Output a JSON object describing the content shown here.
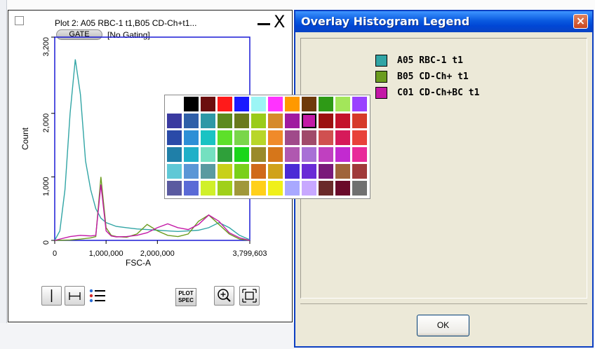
{
  "plot": {
    "title": "Plot 2: A05 RBC-1 t1,B05 CD-Ch+t1...",
    "gate_label": "GATE",
    "gating_status": "[No Gating]",
    "close_glyph": "X",
    "toolbar": {
      "plot_spec_line1": "PLOT",
      "plot_spec_line2": "SPEC"
    }
  },
  "chart_data": {
    "type": "line",
    "title": "",
    "xlabel": "FSC-A",
    "ylabel": "Count",
    "xlim": [
      0,
      3799603
    ],
    "ylim": [
      0,
      3200
    ],
    "x_tick_labels": [
      "0",
      "1,000,000",
      "2,000,000",
      "3,799,603"
    ],
    "x_tick_values": [
      0,
      1000000,
      2000000,
      3799603
    ],
    "y_tick_labels": [
      "0",
      "1,000",
      "2,000",
      "3,200"
    ],
    "y_tick_values": [
      0,
      1000,
      2000,
      3200
    ],
    "series": [
      {
        "color": "#31a5a5",
        "x": [
          0,
          100000,
          200000,
          300000,
          400000,
          500000,
          600000,
          700000,
          800000,
          900000,
          1000000,
          1200000,
          1400000,
          1600000,
          1800000,
          2000000,
          2200000,
          2400000,
          2600000,
          2800000,
          3000000,
          3200000,
          3400000,
          3600000,
          3799603
        ],
        "values": [
          0,
          150,
          800,
          2000,
          2850,
          2300,
          1250,
          800,
          500,
          350,
          280,
          220,
          200,
          180,
          170,
          160,
          150,
          140,
          150,
          160,
          200,
          280,
          200,
          80,
          10
        ]
      },
      {
        "color": "#6b9c1f",
        "x": [
          0,
          300000,
          500000,
          700000,
          800000,
          900000,
          1000000,
          1100000,
          1200000,
          1400000,
          1600000,
          1800000,
          2000000,
          2200000,
          2400000,
          2600000,
          2800000,
          3000000,
          3200000,
          3400000,
          3600000,
          3799603
        ],
        "values": [
          0,
          5,
          20,
          40,
          60,
          1000,
          200,
          80,
          60,
          50,
          100,
          250,
          150,
          80,
          60,
          100,
          300,
          400,
          250,
          100,
          20,
          0
        ]
      },
      {
        "color": "#c318a6",
        "x": [
          0,
          300000,
          500000,
          700000,
          800000,
          900000,
          1000000,
          1100000,
          1200000,
          1400000,
          1600000,
          1800000,
          2000000,
          2200000,
          2400000,
          2600000,
          2800000,
          3000000,
          3200000,
          3400000,
          3600000,
          3799603
        ],
        "values": [
          0,
          60,
          80,
          70,
          80,
          880,
          150,
          70,
          55,
          60,
          80,
          120,
          200,
          260,
          200,
          170,
          250,
          400,
          300,
          120,
          40,
          0
        ]
      }
    ]
  },
  "palette": {
    "colors": [
      "#ffffff",
      "#000000",
      "#6b0e0e",
      "#ff1a1a",
      "#1a1aff",
      "#9cf5f5",
      "#ff33ff",
      "#ff9900",
      "#6e3a0b",
      "#2e9a16",
      "#a3e65a",
      "#9a42ff",
      "#3a3aa0",
      "#2f5fa8",
      "#2e98a6",
      "#5d8a1e",
      "#6a7a1c",
      "#9acc1a",
      "#d68a2a",
      "#a01aa0",
      "#c21aa6",
      "#9c1010",
      "#c4122a",
      "#d63a2a",
      "#2a4aa8",
      "#2d8fd6",
      "#19c3c3",
      "#5de02a",
      "#79d64a",
      "#b8d62a",
      "#f08a2a",
      "#a04a8a",
      "#a04a6a",
      "#d05050",
      "#d61a5a",
      "#e8413a",
      "#1f7fa8",
      "#1fb0c8",
      "#74e0c0",
      "#2fa03a",
      "#1ad61a",
      "#9a8a2a",
      "#d6761a",
      "#b058b0",
      "#a870d6",
      "#c040c0",
      "#c22ad0",
      "#e82a9a",
      "#5fc8d6",
      "#5a96d6",
      "#5a9aa0",
      "#c8d01a",
      "#7ad01a",
      "#d06a1a",
      "#d0a21a",
      "#4a2ad6",
      "#6a2ad6",
      "#7a1a7a",
      "#a0643a",
      "#a03a3a",
      "#5a5aa0",
      "#5a6ad6",
      "#d0f02a",
      "#a0d01a",
      "#a0983a",
      "#ffd01a",
      "#f0f01a",
      "#a8a8ff",
      "#c8a8ff",
      "#6a2a2a",
      "#6a0a2a",
      "#707070"
    ],
    "selected_index": 20
  },
  "legend": {
    "title": "Overlay Histogram Legend",
    "close_glyph": "×",
    "items": [
      {
        "label": "A05 RBC-1 t1",
        "color": "#31a5a5"
      },
      {
        "label": "B05 CD-Ch+ t1",
        "color": "#6b9c1f"
      },
      {
        "label": "C01 CD-Ch+BC t1",
        "color": "#c318a6"
      }
    ],
    "ok_label": "OK"
  }
}
